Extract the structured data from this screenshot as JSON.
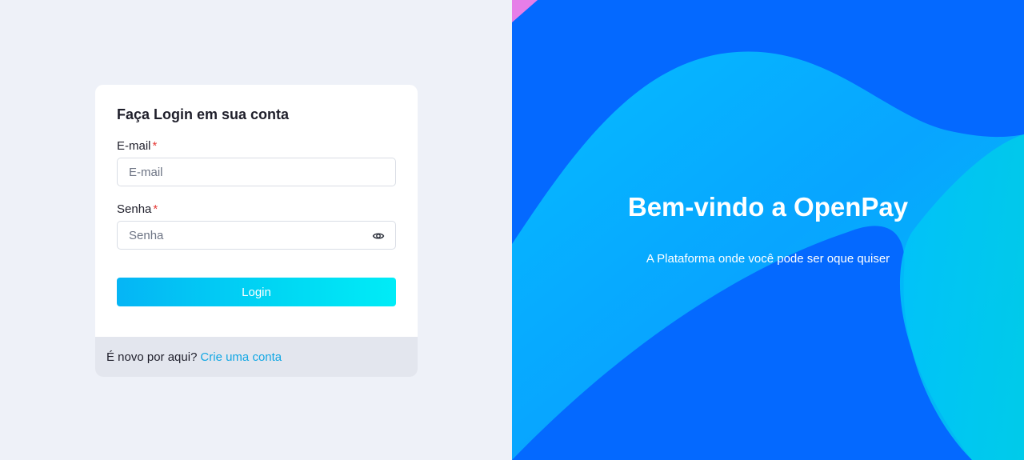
{
  "login_card": {
    "title": "Faça Login em sua conta",
    "email": {
      "label": "E-mail",
      "required_mark": "*",
      "placeholder": "E-mail",
      "value": ""
    },
    "password": {
      "label": "Senha",
      "required_mark": "*",
      "placeholder": "Senha",
      "value": ""
    },
    "submit_label": "Login",
    "footer": {
      "prompt": "É novo por aqui?",
      "link_label": "Crie uma conta"
    }
  },
  "hero": {
    "title": "Bem-vindo a OpenPay",
    "subtitle": "A Plataforma onde você pode ser oque quiser"
  },
  "colors": {
    "left_bg": "#eef1f8",
    "hero_blue": "#0469ff",
    "hero_cyan": "#00c4f5",
    "button_gradient_start": "#05b5f5",
    "button_gradient_end": "#00ecf7",
    "link": "#12a7e4",
    "required": "#e53935",
    "accent_corner": "#e67ee8"
  },
  "icons": {
    "password_toggle": "eye-icon"
  }
}
